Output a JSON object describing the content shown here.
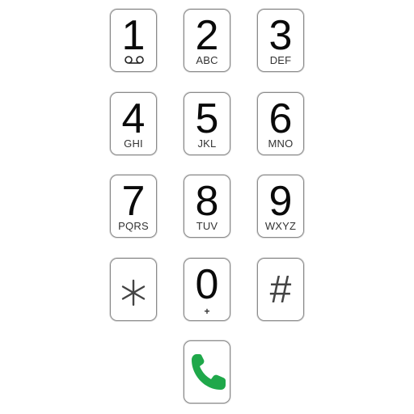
{
  "keys": [
    {
      "digit": "1",
      "sub": "",
      "sub_icon": "voicemail-icon"
    },
    {
      "digit": "2",
      "sub": "ABC"
    },
    {
      "digit": "3",
      "sub": "DEF"
    },
    {
      "digit": "4",
      "sub": "GHI"
    },
    {
      "digit": "5",
      "sub": "JKL"
    },
    {
      "digit": "6",
      "sub": "MNO"
    },
    {
      "digit": "7",
      "sub": "PQRS"
    },
    {
      "digit": "8",
      "sub": "TUV"
    },
    {
      "digit": "9",
      "sub": "WXYZ"
    },
    {
      "digit": "*",
      "sub": ""
    },
    {
      "digit": "0",
      "sub": "+"
    },
    {
      "digit": "#",
      "sub": ""
    }
  ],
  "call": {
    "icon": "phone-call-icon",
    "color": "#1fa84a"
  }
}
